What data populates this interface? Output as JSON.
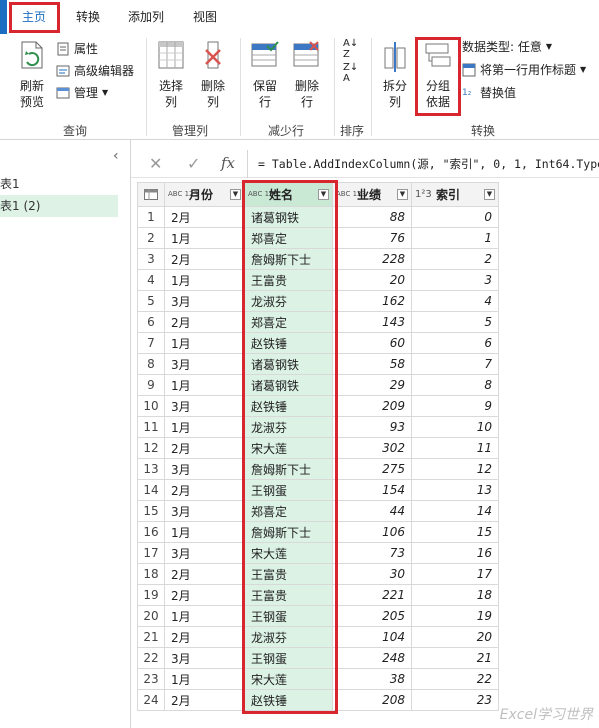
{
  "tabs": [
    "主页",
    "转换",
    "添加列",
    "视图"
  ],
  "ribbon": {
    "refresh_preview": "刷新\n预览",
    "properties": "属性",
    "advanced_editor": "高级编辑器",
    "manage": "管理",
    "query_group": "查询",
    "choose_columns": "选择\n列",
    "remove_columns": "删除\n列",
    "manage_columns_group": "管理列",
    "keep_rows": "保留\n行",
    "remove_rows": "删除\n行",
    "reduce_rows_group": "减少行",
    "sort_group": "排序",
    "split_column": "拆分\n列",
    "group_by": "分组\n依据",
    "data_type": "数据类型: 任意",
    "use_first_row": "将第一行用作标题",
    "replace_values": "替换值",
    "transform_group": "转换"
  },
  "queries": [
    "表1",
    "表1 (2)"
  ],
  "formula": "= Table.AddIndexColumn(源, \"索引\", 0, 1, Int64.Type)",
  "columns": [
    {
      "type": "ABC 123",
      "name": "月份"
    },
    {
      "type": "ABC 123",
      "name": "姓名"
    },
    {
      "type": "ABC 123",
      "name": "业绩"
    },
    {
      "type": "1²3",
      "name": "索引"
    }
  ],
  "rows": [
    [
      "1",
      "2月",
      "诸葛钢铁",
      "88",
      "0"
    ],
    [
      "2",
      "1月",
      "郑喜定",
      "76",
      "1"
    ],
    [
      "3",
      "2月",
      "詹姆斯下士",
      "228",
      "2"
    ],
    [
      "4",
      "1月",
      "王富贵",
      "20",
      "3"
    ],
    [
      "5",
      "3月",
      "龙淑芬",
      "162",
      "4"
    ],
    [
      "6",
      "2月",
      "郑喜定",
      "143",
      "5"
    ],
    [
      "7",
      "1月",
      "赵铁锤",
      "60",
      "6"
    ],
    [
      "8",
      "3月",
      "诸葛钢铁",
      "58",
      "7"
    ],
    [
      "9",
      "1月",
      "诸葛钢铁",
      "29",
      "8"
    ],
    [
      "10",
      "3月",
      "赵铁锤",
      "209",
      "9"
    ],
    [
      "11",
      "1月",
      "龙淑芬",
      "93",
      "10"
    ],
    [
      "12",
      "2月",
      "宋大莲",
      "302",
      "11"
    ],
    [
      "13",
      "3月",
      "詹姆斯下士",
      "275",
      "12"
    ],
    [
      "14",
      "2月",
      "王钢蛋",
      "154",
      "13"
    ],
    [
      "15",
      "3月",
      "郑喜定",
      "44",
      "14"
    ],
    [
      "16",
      "1月",
      "詹姆斯下士",
      "106",
      "15"
    ],
    [
      "17",
      "3月",
      "宋大莲",
      "73",
      "16"
    ],
    [
      "18",
      "2月",
      "王富贵",
      "30",
      "17"
    ],
    [
      "19",
      "2月",
      "王富贵",
      "221",
      "18"
    ],
    [
      "20",
      "1月",
      "王钢蛋",
      "205",
      "19"
    ],
    [
      "21",
      "2月",
      "龙淑芬",
      "104",
      "20"
    ],
    [
      "22",
      "3月",
      "王钢蛋",
      "248",
      "21"
    ],
    [
      "23",
      "1月",
      "宋大莲",
      "38",
      "22"
    ],
    [
      "24",
      "2月",
      "赵铁锤",
      "208",
      "23"
    ]
  ],
  "watermark": "Excel学习世界",
  "colors": {
    "highlight_red": "#d7262e",
    "name_col_bg": "#dcf2e5",
    "tab_blue": "#1b6ec2"
  }
}
